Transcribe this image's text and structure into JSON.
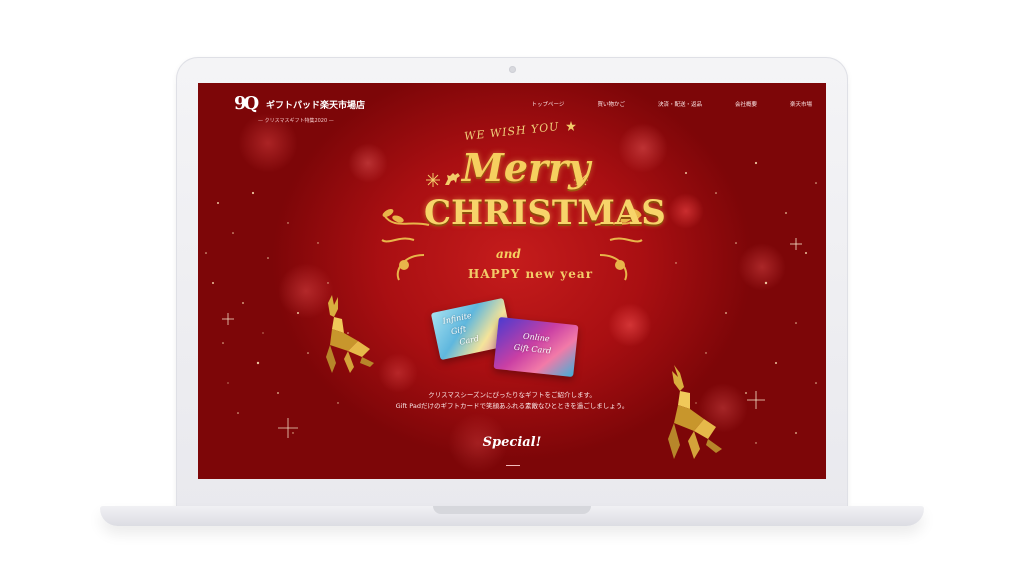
{
  "brand": {
    "logo_text": "9Q",
    "name": "ギフトパッド楽天市場店",
    "subtitle": "— クリスマスギフト特集2020 —"
  },
  "nav": {
    "items": [
      {
        "label": "トップページ"
      },
      {
        "label": "買い物かご"
      },
      {
        "label": "決済・配送・返品"
      },
      {
        "label": "会社概要"
      },
      {
        "label": "楽天市場"
      }
    ]
  },
  "hero": {
    "wish": "WE WISH YOU",
    "merry": "Merry",
    "christmas": "CHRISTMAS",
    "and": "and",
    "happy_new_year": "HAPPY new year"
  },
  "cards": [
    {
      "label_line1": "Infinite",
      "label_line2": "Gift",
      "label_line3": "Card"
    },
    {
      "label_line1": "Online",
      "label_line2": "Gift Card"
    }
  ],
  "description": {
    "line1": "クリスマスシーズンにぴったりなギフトをご紹介します。",
    "line2": "Gift Padだけのギフトカードで笑顔あふれる素敵なひとときを過ごしましょう。"
  },
  "section": {
    "special": "Special!"
  },
  "colors": {
    "background_red": "#a90f12",
    "gold": "#f6cf5f",
    "mockup": "#eeeef1"
  }
}
